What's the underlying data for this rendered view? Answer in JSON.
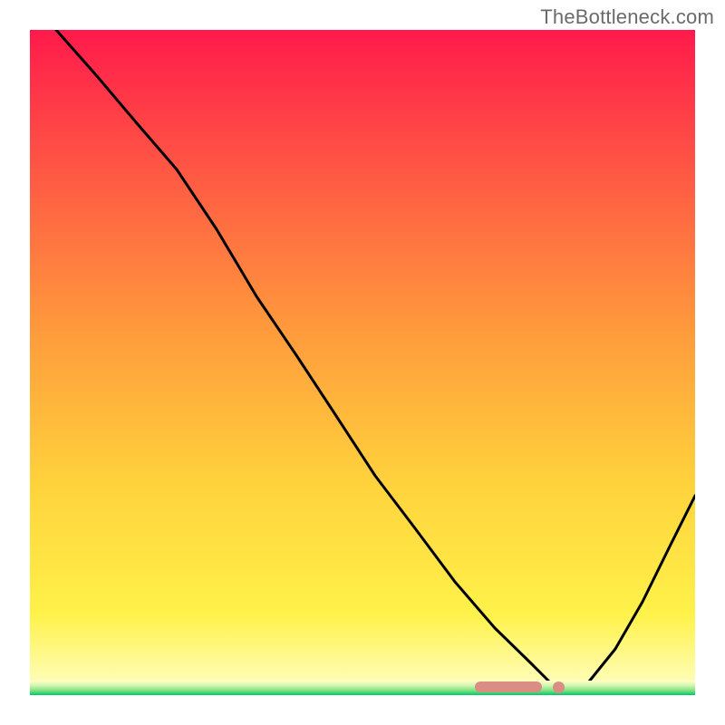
{
  "watermark": "TheBottleneck.com",
  "colors": {
    "gradient_top": "#ff1a4b",
    "gradient_mid1": "#ff6a3c",
    "gradient_mid2": "#ffb53c",
    "gradient_mid3": "#ffe84a",
    "gradient_bottom": "#ffffcc",
    "band_green": "#00c864",
    "line": "#000000",
    "marker": "#d98d83",
    "watermark_text": "#6a6a6a"
  },
  "chart_data": {
    "type": "line",
    "title": "",
    "xlabel": "",
    "ylabel": "",
    "xlim": [
      0,
      100
    ],
    "ylim": [
      0,
      100
    ],
    "x": [
      4,
      10,
      16,
      22,
      28,
      34,
      40,
      46,
      52,
      58,
      64,
      70,
      75,
      78,
      80,
      82,
      84,
      88,
      92,
      96,
      100
    ],
    "values": [
      100,
      93,
      86,
      79,
      70,
      60,
      51,
      42,
      33,
      25,
      17,
      10,
      5,
      2,
      0.5,
      0.5,
      2,
      7,
      14,
      22,
      30
    ],
    "optimal_region": {
      "start": 70,
      "end": 84
    },
    "legend": "off",
    "grid": "off"
  }
}
